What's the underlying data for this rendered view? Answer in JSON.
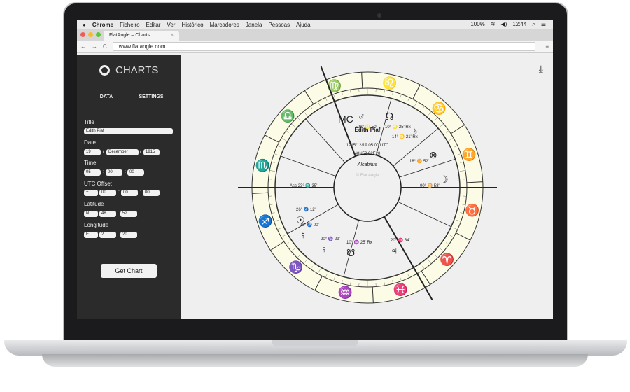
{
  "menubar": {
    "app": "Chrome",
    "items": [
      "Ficheiro",
      "Editar",
      "Ver",
      "Histórico",
      "Marcadores",
      "Janela",
      "Pessoas",
      "Ajuda"
    ],
    "battery": "100%",
    "time": "12:44"
  },
  "browser": {
    "tab_title": "FlatAngle – Charts",
    "url": "www.flatangle.com"
  },
  "sidebar": {
    "logo": "CHARTS",
    "tabs": [
      "DATA",
      "SETTINGS"
    ],
    "title_label": "Title",
    "title_value": "Édith Piaf",
    "date_label": "Date",
    "day": "19",
    "month": "December",
    "year": "1915",
    "time_label": "Time",
    "hour": "05",
    "minute": "00",
    "second": "00",
    "utc_label": "UTC Offset",
    "utc_sign": "+",
    "utc_h": "00",
    "utc_m": "00",
    "utc_s": "00",
    "lat_label": "Latitude",
    "lat_dir": "N",
    "lat_deg": "48",
    "lat_min": "52",
    "lon_label": "Longitude",
    "lon_dir": "E",
    "lon_deg": "2",
    "lon_min": "20",
    "get_chart": "Get Chart"
  },
  "chart": {
    "name": "Édith Piaf",
    "datetime": "1915/12/19 05:00 UTC",
    "coords": "48N52 02E20",
    "system": "Alcabitus",
    "credit": "© Flat Angle",
    "signs": [
      "♍",
      "♌",
      "♋",
      "♊",
      "♉",
      "♈",
      "♓",
      "♒",
      "♑",
      "♐",
      "♏",
      "♎"
    ],
    "sign_colors": {
      "fire": "#d0202a",
      "earth": "#9a9a1c",
      "air": "#7b3fc8",
      "water": "#2336a8"
    },
    "planets": [
      {
        "glyph": "♂",
        "label": "28° ♌ 50'"
      },
      {
        "glyph": "☊",
        "label": "10° ♌ 25' Rx"
      },
      {
        "glyph": "♄",
        "label": "14° ♋ 21' Rx"
      },
      {
        "glyph": "⊗",
        "label": "18° ♊ 52'"
      },
      {
        "glyph": "☽",
        "label": "00° ♊ 58'"
      },
      {
        "glyph": "☉",
        "label": "26° ♐ 12'"
      },
      {
        "glyph": "☿",
        "label": "28° ♐ 00'"
      },
      {
        "glyph": "♀",
        "label": "20° ♑ 29'"
      },
      {
        "glyph": "☋",
        "label": "10° ♒ 25' Rx"
      },
      {
        "glyph": "♃",
        "label": "20° ♓ 34'"
      }
    ],
    "asc": "Asc 23° ♏ 35'",
    "mc": "MC"
  }
}
